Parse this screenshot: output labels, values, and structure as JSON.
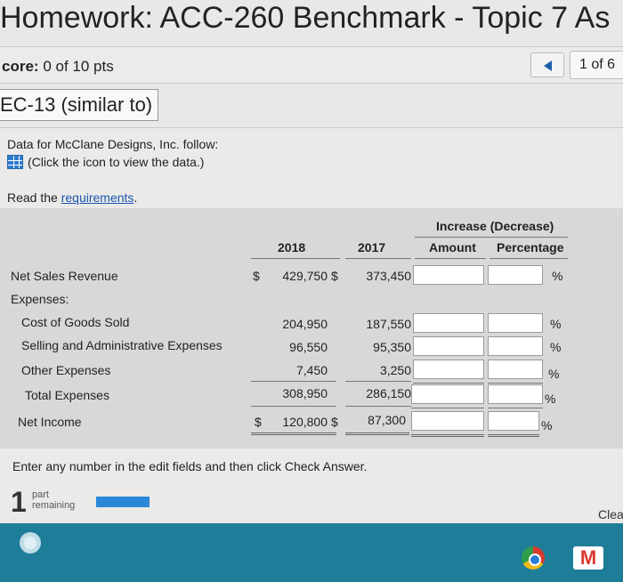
{
  "header": {
    "title": "Homework: ACC-260 Benchmark - Topic 7 As"
  },
  "scorebar": {
    "score_label": "core:",
    "score_value": "0 of 10 pts",
    "pager": "1 of 6"
  },
  "question": {
    "id": "EC-13 (similar to)"
  },
  "intro": {
    "line1": "Data for McClane Designs, Inc. follow:",
    "line2": "(Click the icon to view the data.)",
    "req_prefix": "Read the ",
    "req_link": "requirements",
    "req_suffix": "."
  },
  "table": {
    "header_group": "Increase (Decrease)",
    "columns": [
      "2018",
      "2017",
      "Amount",
      "Percentage"
    ],
    "rows": [
      {
        "label": "Net Sales Revenue",
        "dollar1": "$",
        "v2018": "429,750",
        "dollar2": "$",
        "v2017": "373,450",
        "pct": "%"
      },
      {
        "label": "Expenses:"
      },
      {
        "label": "Cost of Goods Sold",
        "v2018": "204,950",
        "v2017": "187,550",
        "pct": "%"
      },
      {
        "label": "Selling and Administrative Expenses",
        "v2018": "96,550",
        "v2017": "95,350",
        "pct": "%"
      },
      {
        "label": "Other Expenses",
        "v2018": "7,450",
        "v2017": "3,250",
        "pct": "%"
      },
      {
        "label": "Total Expenses",
        "v2018": "308,950",
        "v2017": "286,150",
        "pct": "%"
      },
      {
        "label": "Net Income",
        "dollar1": "$",
        "v2018": "120,800",
        "dollar2": "$",
        "v2017": "87,300",
        "pct": "%"
      }
    ]
  },
  "footer": {
    "instructions": "Enter any number in the edit fields and then click Check Answer.",
    "parts_count": "1",
    "parts_line1": "part",
    "parts_line2": "remaining",
    "clear": "Clea"
  },
  "colors": {
    "accent": "#2b88d9",
    "taskbar": "#1e7d98",
    "link": "#1a55b0"
  }
}
